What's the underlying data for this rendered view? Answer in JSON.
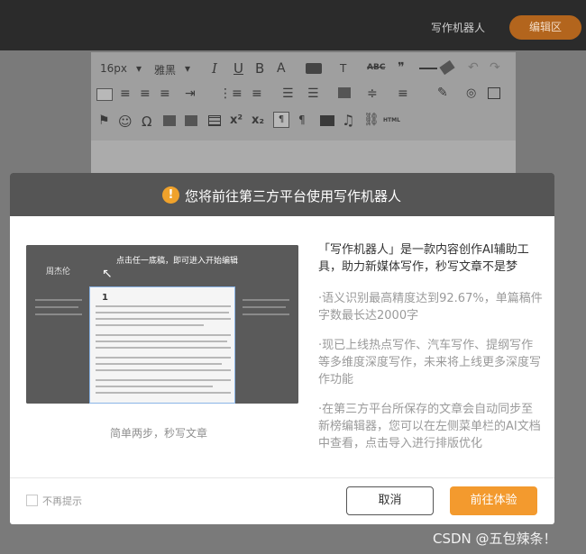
{
  "topbar": {
    "link_label": "写作机器人",
    "edit_button": "编辑区"
  },
  "toolbar": {
    "font_size": "16px",
    "font_family": "雅黑",
    "row1_icons": [
      "italic-icon",
      "underline-icon",
      "bold-icon",
      "font-color-icon",
      "bg-color-icon",
      "text-style-icon",
      "strikethrough-icon",
      "quote-icon",
      "hr-icon",
      "eraser-icon",
      "undo-icon",
      "redo-icon"
    ],
    "row2_icons": [
      "align-left-icon",
      "align-center-icon",
      "align-right-icon",
      "justify-icon",
      "indent-icon",
      "ordered-list-icon",
      "unordered-list-icon",
      "line-height-icon",
      "paragraph-spacing-icon",
      "heading-icon",
      "spacing-icon",
      "list-style-icon",
      "format-brush-icon",
      "search-icon",
      "preview-icon"
    ],
    "row3_icons": [
      "stamp-icon",
      "emoji-icon",
      "omega-icon",
      "image-icon",
      "image-edit-icon",
      "table-icon",
      "superscript-icon",
      "subscript-icon",
      "ltr-icon",
      "rtl-icon",
      "video-icon",
      "music-icon",
      "link-icon",
      "html-icon"
    ],
    "symbols": {
      "italic": "I",
      "underline": "U",
      "bold": "B",
      "font_color": "A",
      "strike": "ABC",
      "quote": "❞",
      "superscript": "x²",
      "subscript": "x₂",
      "html": "HTML",
      "omega": "Ω",
      "emoji": "☺",
      "music": "♫"
    }
  },
  "watermark": "CSDN @五包辣条！",
  "modal": {
    "title": "您将前往第三方平台使用写作机器人",
    "warning_glyph": "!",
    "preview": {
      "hint": "点击任一底稿，即可进入开始编辑",
      "sub": "周杰伦",
      "page_number": "1"
    },
    "caption": "简单两步，秒写文章",
    "description": "「写作机器人」是一款内容创作AI辅助工具，助力新媒体写作，秒写文章不是梦",
    "bullets": [
      "·语义识别最高精度达到92.67%，单篇稿件字数最长达2000字",
      "·现已上线热点写作、汽车写作、提纲写作等多维度深度写作，未来将上线更多深度写作功能",
      "·在第三方平台所保存的文章会自动同步至新榜编辑器，您可以在左侧菜单栏的AI文档中查看，点击导入进行排版优化"
    ],
    "checkbox_label": "不再提示",
    "cancel_button": "取消",
    "confirm_button": "前往体验"
  },
  "colors": {
    "accent": "#f39a2e",
    "topbar_bg": "#2b2b2b",
    "modal_header_bg": "#555555",
    "warning": "#f0a22b"
  }
}
